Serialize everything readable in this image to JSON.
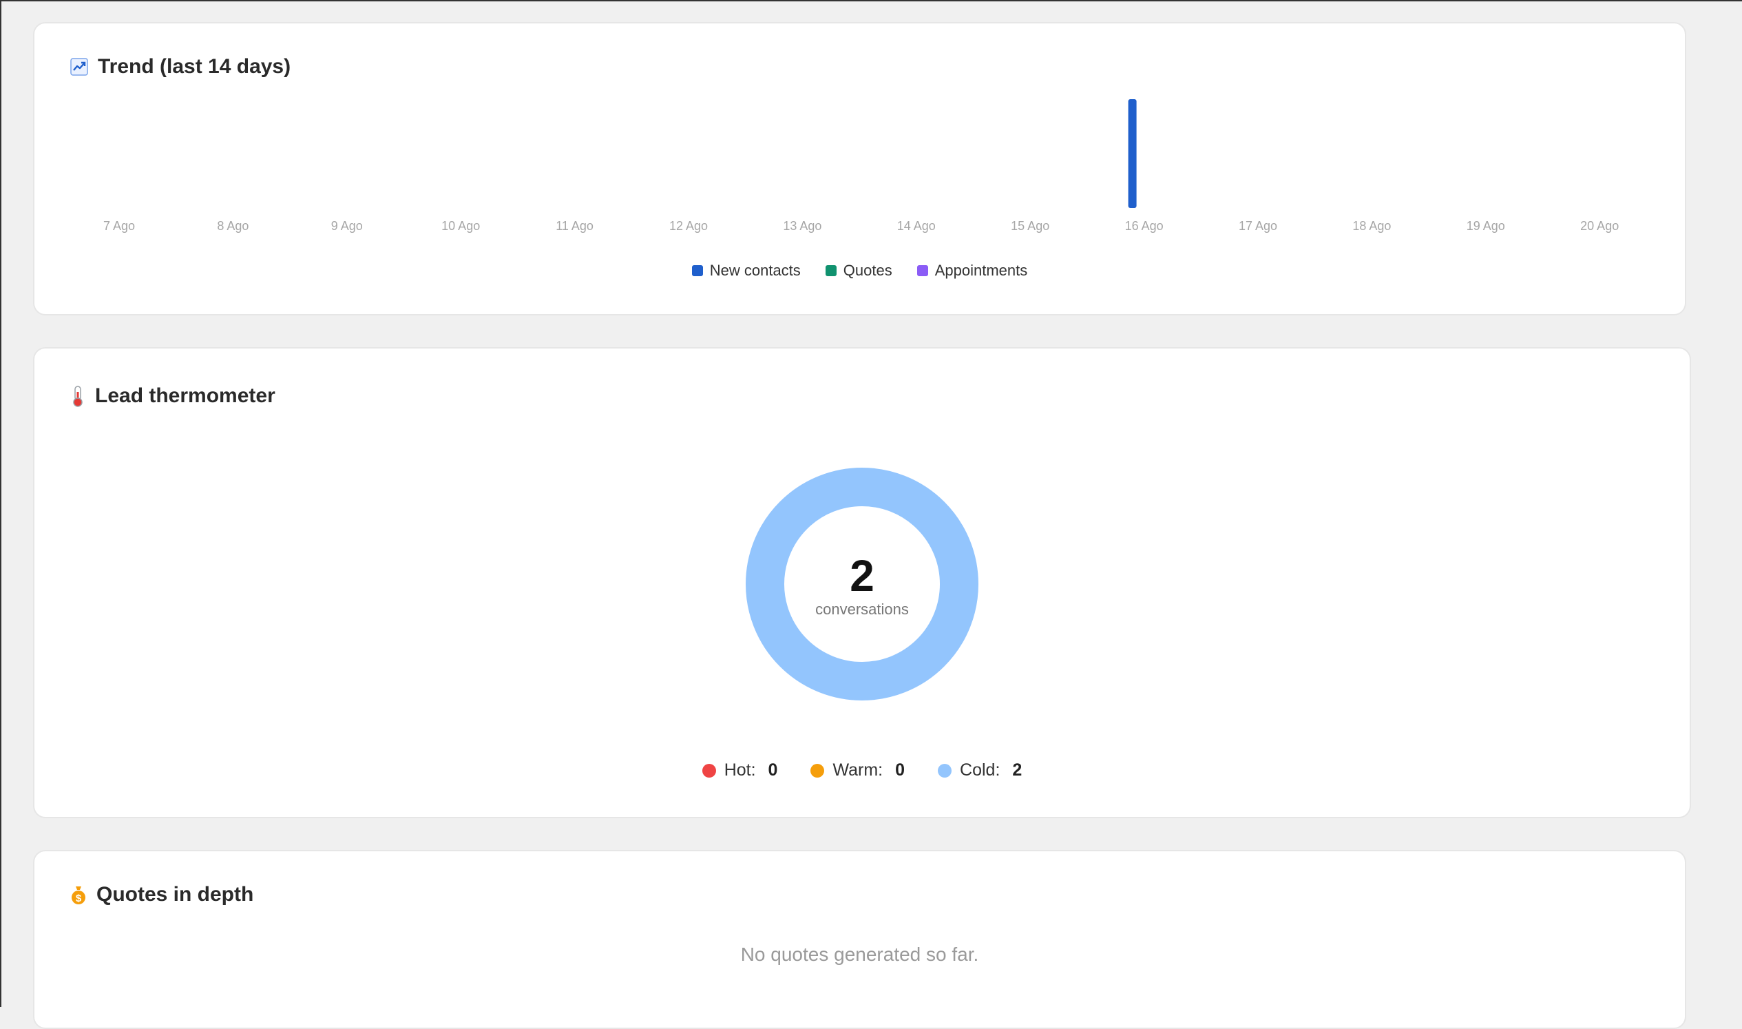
{
  "trend": {
    "title": "Trend (last 14 days)",
    "icon": "chart-trend-icon"
  },
  "chart_data": {
    "type": "bar",
    "categories": [
      "7 Ago",
      "8 Ago",
      "9 Ago",
      "10 Ago",
      "11 Ago",
      "12 Ago",
      "13 Ago",
      "14 Ago",
      "15 Ago",
      "16 Ago",
      "17 Ago",
      "18 Ago",
      "19 Ago",
      "20 Ago"
    ],
    "series": [
      {
        "name": "New contacts",
        "color": "#1f5fcc",
        "values": [
          0,
          0,
          0,
          0,
          0,
          0,
          0,
          0,
          0,
          2,
          0,
          0,
          0,
          0
        ]
      },
      {
        "name": "Quotes",
        "color": "#10926f",
        "values": [
          0,
          0,
          0,
          0,
          0,
          0,
          0,
          0,
          0,
          0,
          0,
          0,
          0,
          0
        ]
      },
      {
        "name": "Appointments",
        "color": "#8b5cf6",
        "values": [
          0,
          0,
          0,
          0,
          0,
          0,
          0,
          0,
          0,
          0,
          0,
          0,
          0,
          0
        ]
      }
    ],
    "title": "Trend (last 14 days)",
    "xlabel": "",
    "ylabel": "",
    "grid": false,
    "legend": "bottom-center"
  },
  "thermometer": {
    "title": "Lead thermometer",
    "icon": "thermometer-icon",
    "total": "2",
    "caption": "conversations",
    "segments": [
      {
        "label": "Hot:",
        "value": "0",
        "color": "#ef4444"
      },
      {
        "label": "Warm:",
        "value": "0",
        "color": "#f59e0b"
      },
      {
        "label": "Cold:",
        "value": "2",
        "color": "#93c5fd"
      }
    ]
  },
  "quotes": {
    "title": "Quotes in depth",
    "icon": "money-bag-icon",
    "empty_text": "No quotes generated so far."
  }
}
